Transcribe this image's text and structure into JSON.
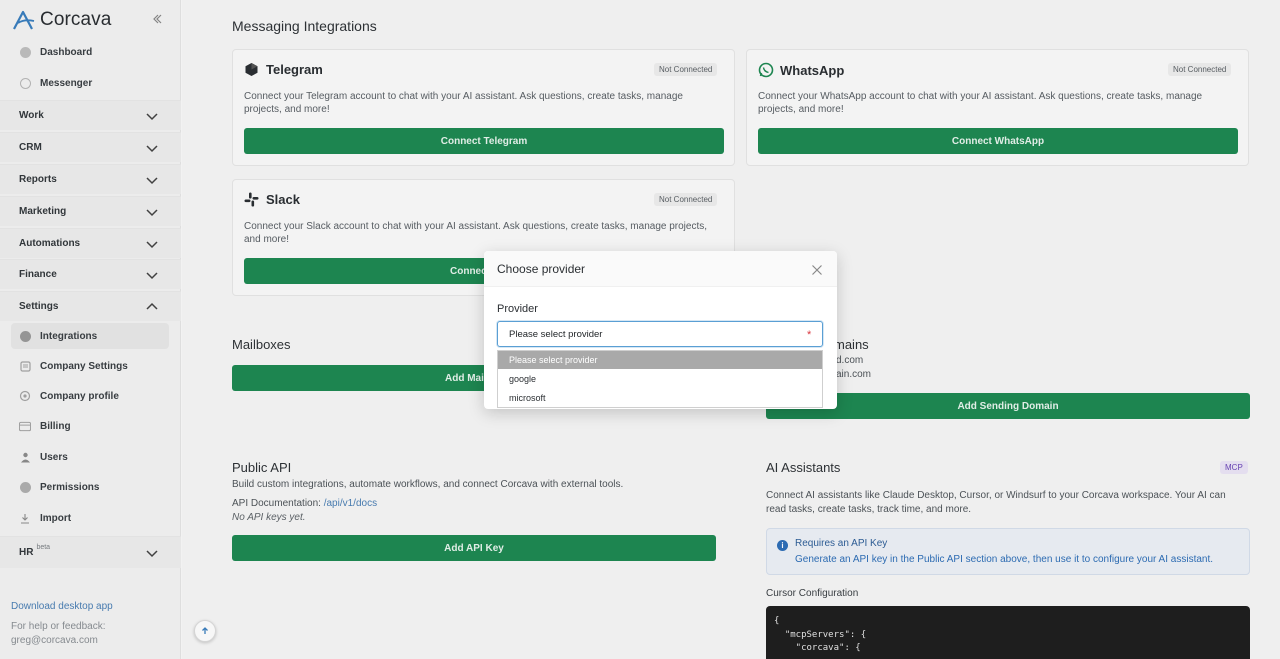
{
  "app": {
    "name": "Corcava"
  },
  "sidebar": {
    "items": [
      {
        "label": "Dashboard",
        "icon": "dashboard-icon"
      },
      {
        "label": "Messenger",
        "icon": "messenger-icon"
      }
    ],
    "sections": [
      {
        "label": "Work"
      },
      {
        "label": "CRM"
      },
      {
        "label": "Reports"
      },
      {
        "label": "Marketing"
      },
      {
        "label": "Automations"
      },
      {
        "label": "Finance"
      },
      {
        "label": "Settings"
      }
    ],
    "settings_items": [
      {
        "label": "Integrations",
        "icon": "integrations-icon"
      },
      {
        "label": "Company Settings",
        "icon": "company-settings-icon"
      },
      {
        "label": "Company profile",
        "icon": "company-profile-icon"
      },
      {
        "label": "Billing",
        "icon": "billing-icon"
      },
      {
        "label": "Users",
        "icon": "users-icon"
      },
      {
        "label": "Permissions",
        "icon": "permissions-icon"
      },
      {
        "label": "Import",
        "icon": "import-icon"
      }
    ],
    "hr": {
      "label": "HR",
      "tag": "beta"
    },
    "download_link": "Download desktop app",
    "help_line1": "For help or feedback:",
    "help_email": "greg@corcava.com"
  },
  "main": {
    "title": "Messaging Integrations",
    "telegram": {
      "title": "Telegram",
      "status": "Not Connected",
      "desc": "Connect your Telegram account to chat with your AI assistant. Ask questions, create tasks, manage projects, and more!",
      "button": "Connect Telegram"
    },
    "whatsapp": {
      "title": "WhatsApp",
      "status": "Not Connected",
      "desc": "Connect your WhatsApp account to chat with your AI assistant. Ask questions, create tasks, manage projects, and more!",
      "button": "Connect WhatsApp"
    },
    "slack": {
      "title": "Slack",
      "status": "Not Connected",
      "desc": "Connect your Slack account to chat with your AI assistant. Ask questions, create tasks, manage projects, and more!",
      "button_partial": "Connec"
    },
    "mailboxes": {
      "title": "Mailboxes",
      "button_partial": "Add Mai"
    },
    "sending_domains": {
      "title_partial": "mains",
      "domain1_partial": "d.com",
      "domain2_partial": "ain.com",
      "button": "Add Sending Domain"
    },
    "public_api": {
      "title": "Public API",
      "desc": "Build custom integrations, automate workflows, and connect Corcava with external tools.",
      "doc_label": "API Documentation:",
      "doc_link": "/api/v1/docs",
      "empty": "No API keys yet.",
      "button": "Add API Key"
    },
    "ai_assistants": {
      "title": "AI Assistants",
      "badge": "MCP",
      "desc": "Connect AI assistants like Claude Desktop, Cursor, or Windsurf to your Corcava workspace. Your AI can read tasks, create tasks, track time, and more.",
      "info_title": "Requires an API Key",
      "info_desc": "Generate an API key in the Public API section above, then use it to configure your AI assistant.",
      "config_label": "Cursor Configuration",
      "code": "{\n  \"mcpServers\": {\n    \"corcava\": {"
    }
  },
  "modal": {
    "title": "Choose provider",
    "field_label": "Provider",
    "select_value": "Please select provider",
    "required_mark": "*",
    "options": [
      "Please select provider",
      "google",
      "microsoft"
    ]
  },
  "colors": {
    "primary_green": "#1e8a53",
    "link_blue": "#4a7fb5",
    "required_red": "#d9363e"
  }
}
